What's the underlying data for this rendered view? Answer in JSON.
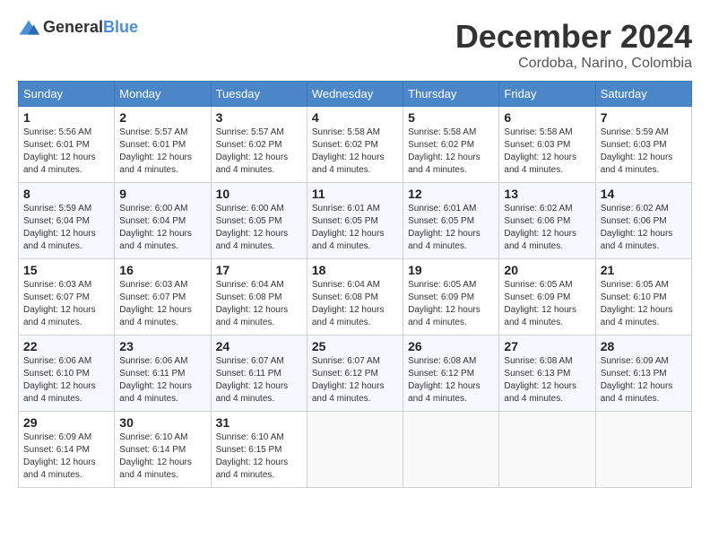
{
  "logo": {
    "general": "General",
    "blue": "Blue"
  },
  "title": {
    "month_year": "December 2024",
    "location": "Cordoba, Narino, Colombia"
  },
  "headers": [
    "Sunday",
    "Monday",
    "Tuesday",
    "Wednesday",
    "Thursday",
    "Friday",
    "Saturday"
  ],
  "weeks": [
    [
      {
        "day": "1",
        "sunrise": "5:56 AM",
        "sunset": "6:01 PM",
        "daylight": "12 hours and 4 minutes."
      },
      {
        "day": "2",
        "sunrise": "5:57 AM",
        "sunset": "6:01 PM",
        "daylight": "12 hours and 4 minutes."
      },
      {
        "day": "3",
        "sunrise": "5:57 AM",
        "sunset": "6:02 PM",
        "daylight": "12 hours and 4 minutes."
      },
      {
        "day": "4",
        "sunrise": "5:58 AM",
        "sunset": "6:02 PM",
        "daylight": "12 hours and 4 minutes."
      },
      {
        "day": "5",
        "sunrise": "5:58 AM",
        "sunset": "6:02 PM",
        "daylight": "12 hours and 4 minutes."
      },
      {
        "day": "6",
        "sunrise": "5:58 AM",
        "sunset": "6:03 PM",
        "daylight": "12 hours and 4 minutes."
      },
      {
        "day": "7",
        "sunrise": "5:59 AM",
        "sunset": "6:03 PM",
        "daylight": "12 hours and 4 minutes."
      }
    ],
    [
      {
        "day": "8",
        "sunrise": "5:59 AM",
        "sunset": "6:04 PM",
        "daylight": "12 hours and 4 minutes."
      },
      {
        "day": "9",
        "sunrise": "6:00 AM",
        "sunset": "6:04 PM",
        "daylight": "12 hours and 4 minutes."
      },
      {
        "day": "10",
        "sunrise": "6:00 AM",
        "sunset": "6:05 PM",
        "daylight": "12 hours and 4 minutes."
      },
      {
        "day": "11",
        "sunrise": "6:01 AM",
        "sunset": "6:05 PM",
        "daylight": "12 hours and 4 minutes."
      },
      {
        "day": "12",
        "sunrise": "6:01 AM",
        "sunset": "6:05 PM",
        "daylight": "12 hours and 4 minutes."
      },
      {
        "day": "13",
        "sunrise": "6:02 AM",
        "sunset": "6:06 PM",
        "daylight": "12 hours and 4 minutes."
      },
      {
        "day": "14",
        "sunrise": "6:02 AM",
        "sunset": "6:06 PM",
        "daylight": "12 hours and 4 minutes."
      }
    ],
    [
      {
        "day": "15",
        "sunrise": "6:03 AM",
        "sunset": "6:07 PM",
        "daylight": "12 hours and 4 minutes."
      },
      {
        "day": "16",
        "sunrise": "6:03 AM",
        "sunset": "6:07 PM",
        "daylight": "12 hours and 4 minutes."
      },
      {
        "day": "17",
        "sunrise": "6:04 AM",
        "sunset": "6:08 PM",
        "daylight": "12 hours and 4 minutes."
      },
      {
        "day": "18",
        "sunrise": "6:04 AM",
        "sunset": "6:08 PM",
        "daylight": "12 hours and 4 minutes."
      },
      {
        "day": "19",
        "sunrise": "6:05 AM",
        "sunset": "6:09 PM",
        "daylight": "12 hours and 4 minutes."
      },
      {
        "day": "20",
        "sunrise": "6:05 AM",
        "sunset": "6:09 PM",
        "daylight": "12 hours and 4 minutes."
      },
      {
        "day": "21",
        "sunrise": "6:05 AM",
        "sunset": "6:10 PM",
        "daylight": "12 hours and 4 minutes."
      }
    ],
    [
      {
        "day": "22",
        "sunrise": "6:06 AM",
        "sunset": "6:10 PM",
        "daylight": "12 hours and 4 minutes."
      },
      {
        "day": "23",
        "sunrise": "6:06 AM",
        "sunset": "6:11 PM",
        "daylight": "12 hours and 4 minutes."
      },
      {
        "day": "24",
        "sunrise": "6:07 AM",
        "sunset": "6:11 PM",
        "daylight": "12 hours and 4 minutes."
      },
      {
        "day": "25",
        "sunrise": "6:07 AM",
        "sunset": "6:12 PM",
        "daylight": "12 hours and 4 minutes."
      },
      {
        "day": "26",
        "sunrise": "6:08 AM",
        "sunset": "6:12 PM",
        "daylight": "12 hours and 4 minutes."
      },
      {
        "day": "27",
        "sunrise": "6:08 AM",
        "sunset": "6:13 PM",
        "daylight": "12 hours and 4 minutes."
      },
      {
        "day": "28",
        "sunrise": "6:09 AM",
        "sunset": "6:13 PM",
        "daylight": "12 hours and 4 minutes."
      }
    ],
    [
      {
        "day": "29",
        "sunrise": "6:09 AM",
        "sunset": "6:14 PM",
        "daylight": "12 hours and 4 minutes."
      },
      {
        "day": "30",
        "sunrise": "6:10 AM",
        "sunset": "6:14 PM",
        "daylight": "12 hours and 4 minutes."
      },
      {
        "day": "31",
        "sunrise": "6:10 AM",
        "sunset": "6:15 PM",
        "daylight": "12 hours and 4 minutes."
      },
      null,
      null,
      null,
      null
    ]
  ],
  "labels": {
    "sunrise": "Sunrise:",
    "sunset": "Sunset:",
    "daylight": "Daylight: 12 hours"
  }
}
